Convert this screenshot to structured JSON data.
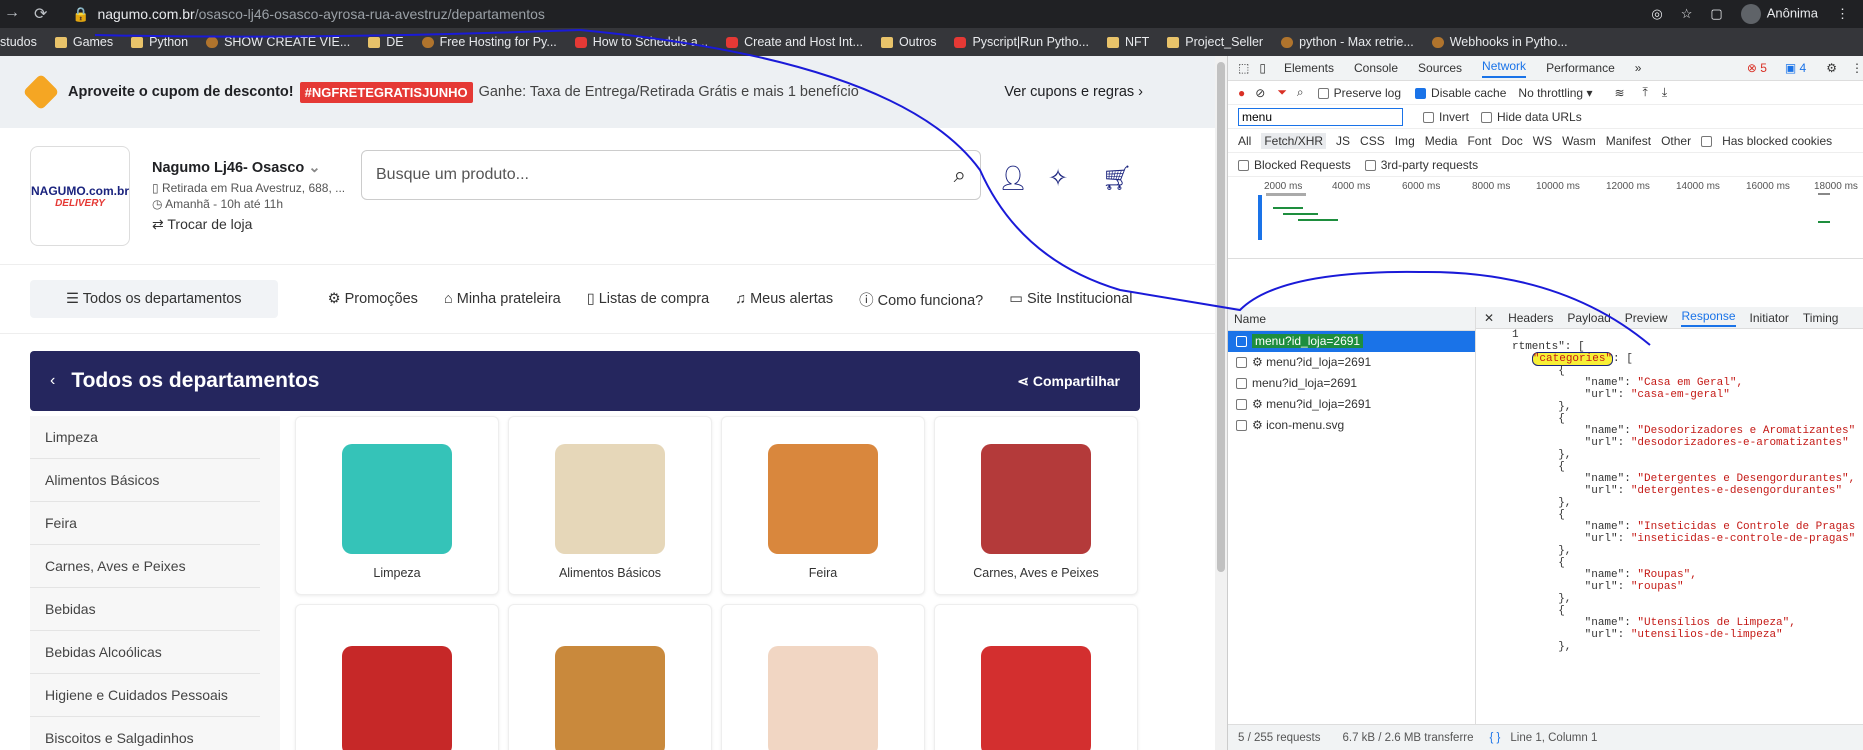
{
  "browser": {
    "url_host": "nagumo.com.br",
    "url_path": "/osasco-lj46-osasco-ayrosa-rua-avestruz/departamentos",
    "profile": "Anônima",
    "bookmarks": [
      {
        "label": "studos",
        "icon": "folder"
      },
      {
        "label": "Games",
        "icon": "folder"
      },
      {
        "label": "Python",
        "icon": "folder"
      },
      {
        "label": "SHOW CREATE VIE...",
        "icon": "other"
      },
      {
        "label": "DE",
        "icon": "folder"
      },
      {
        "label": "Free Hosting for Py...",
        "icon": "other"
      },
      {
        "label": "How to Schedule a...",
        "icon": "yt"
      },
      {
        "label": "Create and Host Int...",
        "icon": "yt"
      },
      {
        "label": "Outros",
        "icon": "folder"
      },
      {
        "label": "Pyscript|Run Pytho...",
        "icon": "yt"
      },
      {
        "label": "NFT",
        "icon": "folder"
      },
      {
        "label": "Project_Seller",
        "icon": "folder"
      },
      {
        "label": "python - Max retrie...",
        "icon": "other"
      },
      {
        "label": "Webhooks in Pytho...",
        "icon": "other"
      }
    ]
  },
  "promo": {
    "text": "Aproveite o cupom de desconto!",
    "coupon": "#NGFRETEGRATISJUNHO",
    "desc": "Ganhe: Taxa de Entrega/Retirada Grátis e mais 1 benefício",
    "link": "Ver cupons e regras ›"
  },
  "header": {
    "logo_top": "NAGUMO.com.br",
    "logo_bottom": "DELIVERY",
    "store_name": "Nagumo Lj46- Osasco",
    "pickup": "Retirada em Rua Avestruz, 688, ...",
    "schedule": "Amanhã - 10h até 11h",
    "change_store": "Trocar de loja",
    "search_placeholder": "Busque um produto..."
  },
  "nav": {
    "departments": "Todos os departamentos",
    "links": [
      "Promoções",
      "Minha prateleira",
      "Listas de compra",
      "Meus alertas",
      "Como funciona?",
      "Site Institucional"
    ]
  },
  "banner": {
    "title": "Todos os departamentos",
    "share": "Compartilhar"
  },
  "category_list": [
    "Limpeza",
    "Alimentos Básicos",
    "Feira",
    "Carnes, Aves e Peixes",
    "Bebidas",
    "Bebidas Alcoólicas",
    "Higiene e Cuidados Pessoais",
    "Biscoitos e Salgadinhos"
  ],
  "tiles": [
    {
      "label": "Limpeza",
      "color": "#35c3b8"
    },
    {
      "label": "Alimentos Básicos",
      "color": "#e6d7b9"
    },
    {
      "label": "Feira",
      "color": "#d9873d"
    },
    {
      "label": "Carnes, Aves e Peixes",
      "color": "#b43a3a"
    },
    {
      "label": "",
      "color": "#c62828"
    },
    {
      "label": "",
      "color": "#c9893c"
    },
    {
      "label": "",
      "color": "#f1d6c3"
    },
    {
      "label": "",
      "color": "#d32f2f"
    }
  ],
  "devtools": {
    "tabs": [
      "Elements",
      "Console",
      "Sources",
      "Network",
      "Performance",
      "»"
    ],
    "errors": "⊗ 5",
    "issues": "▣ 4",
    "preserve_log": "Preserve log",
    "disable_cache": "Disable cache",
    "throttling": "No throttling",
    "filter_value": "menu",
    "invert": "Invert",
    "hide_data": "Hide data URLs",
    "types": [
      "All",
      "Fetch/XHR",
      "JS",
      "CSS",
      "Img",
      "Media",
      "Font",
      "Doc",
      "WS",
      "Wasm",
      "Manifest",
      "Other"
    ],
    "blocked_cookies": "Has blocked cookies",
    "blocked_requests": "Blocked Requests",
    "third_party": "3rd-party requests",
    "timeline_ticks": [
      "2000 ms",
      "4000 ms",
      "6000 ms",
      "8000 ms",
      "10000 ms",
      "12000 ms",
      "14000 ms",
      "16000 ms",
      "18000 ms"
    ],
    "name_header": "Name",
    "requests": [
      "menu?id_loja=2691",
      "⚙ menu?id_loja=2691",
      "menu?id_loja=2691",
      "⚙ menu?id_loja=2691",
      "⚙ icon-menu.svg"
    ],
    "response_tabs": [
      "Headers",
      "Payload",
      "Preview",
      "Response",
      "Initiator",
      "Timing"
    ],
    "code": {
      "l1": "1",
      "l2": "rtments\": [",
      "categories_key": "\"categories\"",
      "items": [
        {
          "name": "\"Casa em Geral\",",
          "url": "\"casa-em-geral\""
        },
        {
          "name": "\"Desodorizadores e Aromatizantes\"",
          "url": "\"desodorizadores-e-aromatizantes\""
        },
        {
          "name": "\"Detergentes e Desengordurantes\",",
          "url": "\"detergentes-e-desengordurantes\""
        },
        {
          "name": "\"Inseticidas e Controle de Pragas",
          "url": "\"inseticidas-e-controle-de-pragas\""
        },
        {
          "name": "\"Roupas\",",
          "url": "\"roupas\""
        },
        {
          "name": "\"Utensílios de Limpeza\",",
          "url": "\"utensilios-de-limpeza\""
        }
      ]
    },
    "status_requests": "5 / 255 requests",
    "status_transfer": "6.7 kB / 2.6 MB transferre",
    "status_cursor": "Line 1, Column 1"
  }
}
